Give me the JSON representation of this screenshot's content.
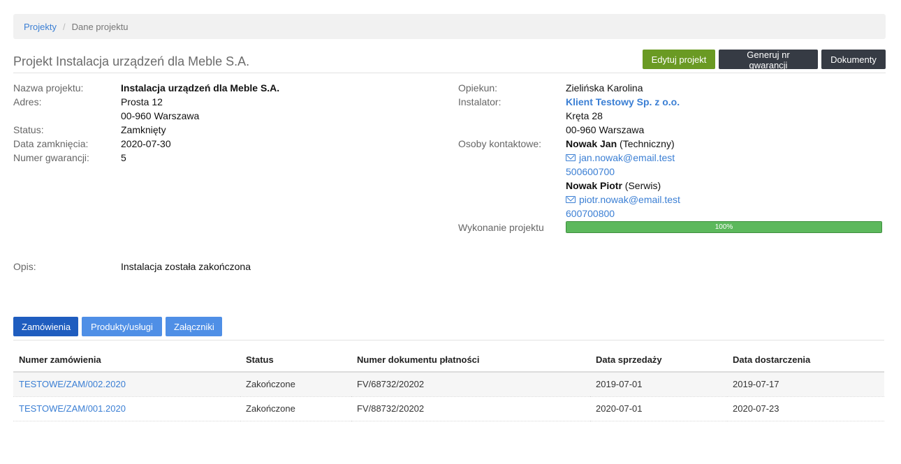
{
  "breadcrumb": {
    "root": "Projekty",
    "current": "Dane projektu"
  },
  "page_title": "Projekt Instalacja urządzeń dla Meble S.A.",
  "actions": {
    "edit": "Edytuj projekt",
    "warranty": "Generuj nr gwarancji",
    "documents": "Dokumenty"
  },
  "colors": {
    "green": "#6a9a23",
    "dark": "#363b44",
    "link": "#3b7fd4",
    "tab": "#4f8fe6",
    "tab_active": "#1f5dbf",
    "progress": "#5cb85c"
  },
  "left": {
    "name_label": "Nazwa projektu:",
    "name_value": "Instalacja urządzeń dla Meble S.A.",
    "address_label": "Adres:",
    "address_line1": "Prosta 12",
    "address_line2": "00-960 Warszawa",
    "status_label": "Status:",
    "status_value": "Zamknięty",
    "closed_label": "Data zamknięcia:",
    "closed_value": "2020-07-30",
    "warranty_label": "Numer gwarancji:",
    "warranty_value": "5"
  },
  "right": {
    "guardian_label": "Opiekun:",
    "guardian_value": "Zielińska Karolina",
    "installer_label": "Instalator:",
    "installer_name": "Klient Testowy Sp. z o.o.",
    "installer_line1": "Kręta 28",
    "installer_line2": "00-960 Warszawa",
    "contacts_label": "Osoby kontaktowe:",
    "contacts": [
      {
        "name": "Nowak Jan",
        "role": "(Techniczny)",
        "email": "jan.nowak@email.test",
        "phone": "500600700",
        "mail_icon": "envelope-icon"
      },
      {
        "name": "Nowak Piotr",
        "role": "(Serwis)",
        "email": "piotr.nowak@email.test",
        "phone": "600700800",
        "mail_icon": "envelope-icon"
      }
    ],
    "progress_label": "Wykonanie projektu",
    "progress_value": 100,
    "progress_text": "100%"
  },
  "opis": {
    "label": "Opis:",
    "value": "Instalacja została zakończona"
  },
  "tabs": [
    {
      "label": "Zamówienia",
      "active": true
    },
    {
      "label": "Produkty/usługi",
      "active": false
    },
    {
      "label": "Załączniki",
      "active": false
    }
  ],
  "orders": {
    "headers": [
      "Numer zamówienia",
      "Status",
      "Numer dokumentu płatności",
      "Data sprzedaży",
      "Data dostarczenia"
    ],
    "rows": [
      {
        "number": "TESTOWE/ZAM/002.2020",
        "status": "Zakończone",
        "payment_doc": "FV/68732/20202",
        "sale_date": "2019-07-01",
        "delivery_date": "2019-07-17"
      },
      {
        "number": "TESTOWE/ZAM/001.2020",
        "status": "Zakończone",
        "payment_doc": "FV/88732/20202",
        "sale_date": "2020-07-01",
        "delivery_date": "2020-07-23"
      }
    ]
  }
}
